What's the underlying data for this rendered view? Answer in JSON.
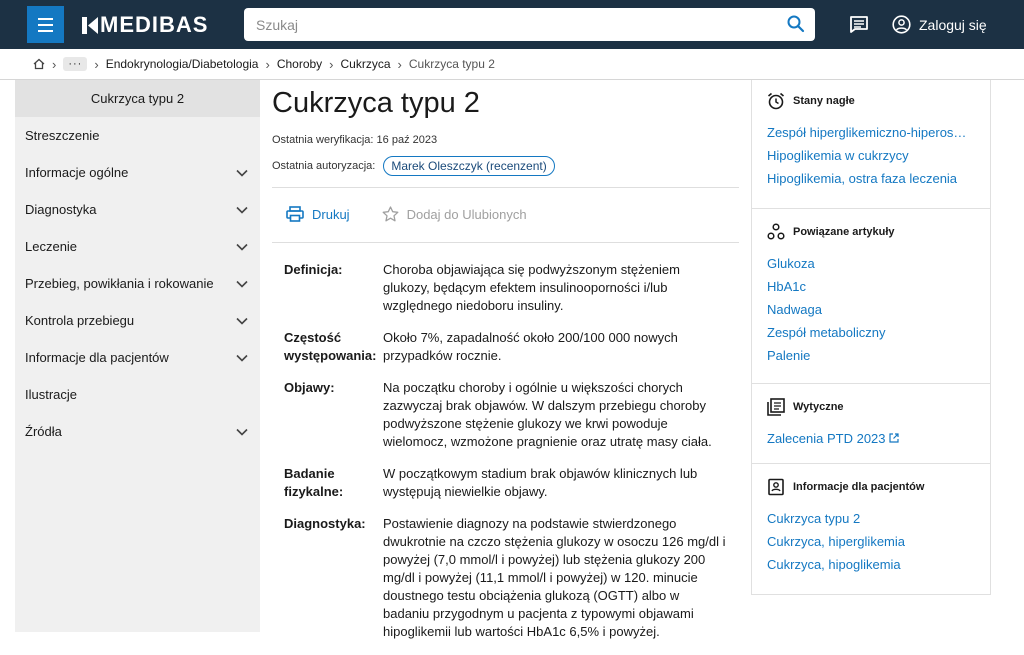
{
  "header": {
    "logo": "MEDIBAS",
    "search_placeholder": "Szukaj",
    "login_label": "Zaloguj się"
  },
  "breadcrumb": {
    "more": "···",
    "items": [
      "Endokrynologia/Diabetologia",
      "Choroby",
      "Cukrzyca"
    ],
    "current": "Cukrzyca typu 2"
  },
  "sidebar": {
    "title": "Cukrzyca typu 2",
    "items": [
      {
        "label": "Streszczenie"
      },
      {
        "label": "Informacje ogólne"
      },
      {
        "label": "Diagnostyka"
      },
      {
        "label": "Leczenie"
      },
      {
        "label": "Przebieg, powikłania i rokowanie"
      },
      {
        "label": "Kontrola przebiegu"
      },
      {
        "label": "Informacje dla pacjentów"
      },
      {
        "label": "Ilustracje"
      },
      {
        "label": "Źródła"
      }
    ]
  },
  "article": {
    "title": "Cukrzyca typu 2",
    "verification": "Ostatnia weryfikacja: 16 paź 2023",
    "authorization_label": "Ostatnia autoryzacja:",
    "reviewer": "Marek Oleszczyk (recenzent)",
    "print_label": "Drukuj",
    "fav_label": "Dodaj do Ulubionych",
    "definitions": [
      {
        "key": "Definicja:",
        "value": "Choroba objawiająca się podwyższonym stężeniem glukozy, będącym efektem insulinooporności i/lub względnego niedoboru insuliny."
      },
      {
        "key": "Częstość występowania:",
        "value": "Około 7%, zapadalność około 200/100 000 nowych przypadków rocznie."
      },
      {
        "key": "Objawy:",
        "value": "Na początku choroby i ogólnie u większości chorych zazwyczaj brak objawów. W dalszym przebiegu choroby podwyższone stężenie glukozy we krwi powoduje wielomocz, wzmożone pragnienie oraz utratę masy ciała."
      },
      {
        "key": "Badanie fizykalne:",
        "value": "W początkowym stadium brak objawów klinicznych lub występują niewielkie objawy."
      },
      {
        "key": "Diagnostyka:",
        "value": "Postawienie diagnozy na podstawie stwierdzonego dwukrotnie na czczo stężenia glukozy w osoczu 126 mg/dl i powyżej (7,0 mmol/l i powyżej) lub stężenia glukozy 200 mg/dl i powyżej (11,1 mmol/l i powyżej) w 120. minucie doustnego testu obciążenia glukozą (OGTT) albo w badaniu przygodnym u pacjenta z typowymi objawami hipoglikemii lub wartości HbA1c 6,5% i powyżej."
      }
    ]
  },
  "right": {
    "emergency": {
      "title": "Stany nagłe",
      "links": [
        "Zespół hiperglikemiczno-hiperosmolarny",
        "Hipoglikemia w cukrzycy",
        "Hipoglikemia, ostra faza leczenia"
      ]
    },
    "related": {
      "title": "Powiązane artykuły",
      "links": [
        "Glukoza",
        "HbA1c",
        "Nadwaga",
        "Zespół metaboliczny",
        "Palenie"
      ]
    },
    "guidelines": {
      "title": "Wytyczne",
      "links": [
        "Zalecenia PTD 2023"
      ]
    },
    "patients": {
      "title": "Informacje dla pacjentów",
      "links": [
        "Cukrzyca typu 2",
        "Cukrzyca, hiperglikemia",
        "Cukrzyca, hipoglikemia"
      ]
    }
  },
  "colors": {
    "header_bg": "#1c3144",
    "accent": "#1478c2"
  }
}
